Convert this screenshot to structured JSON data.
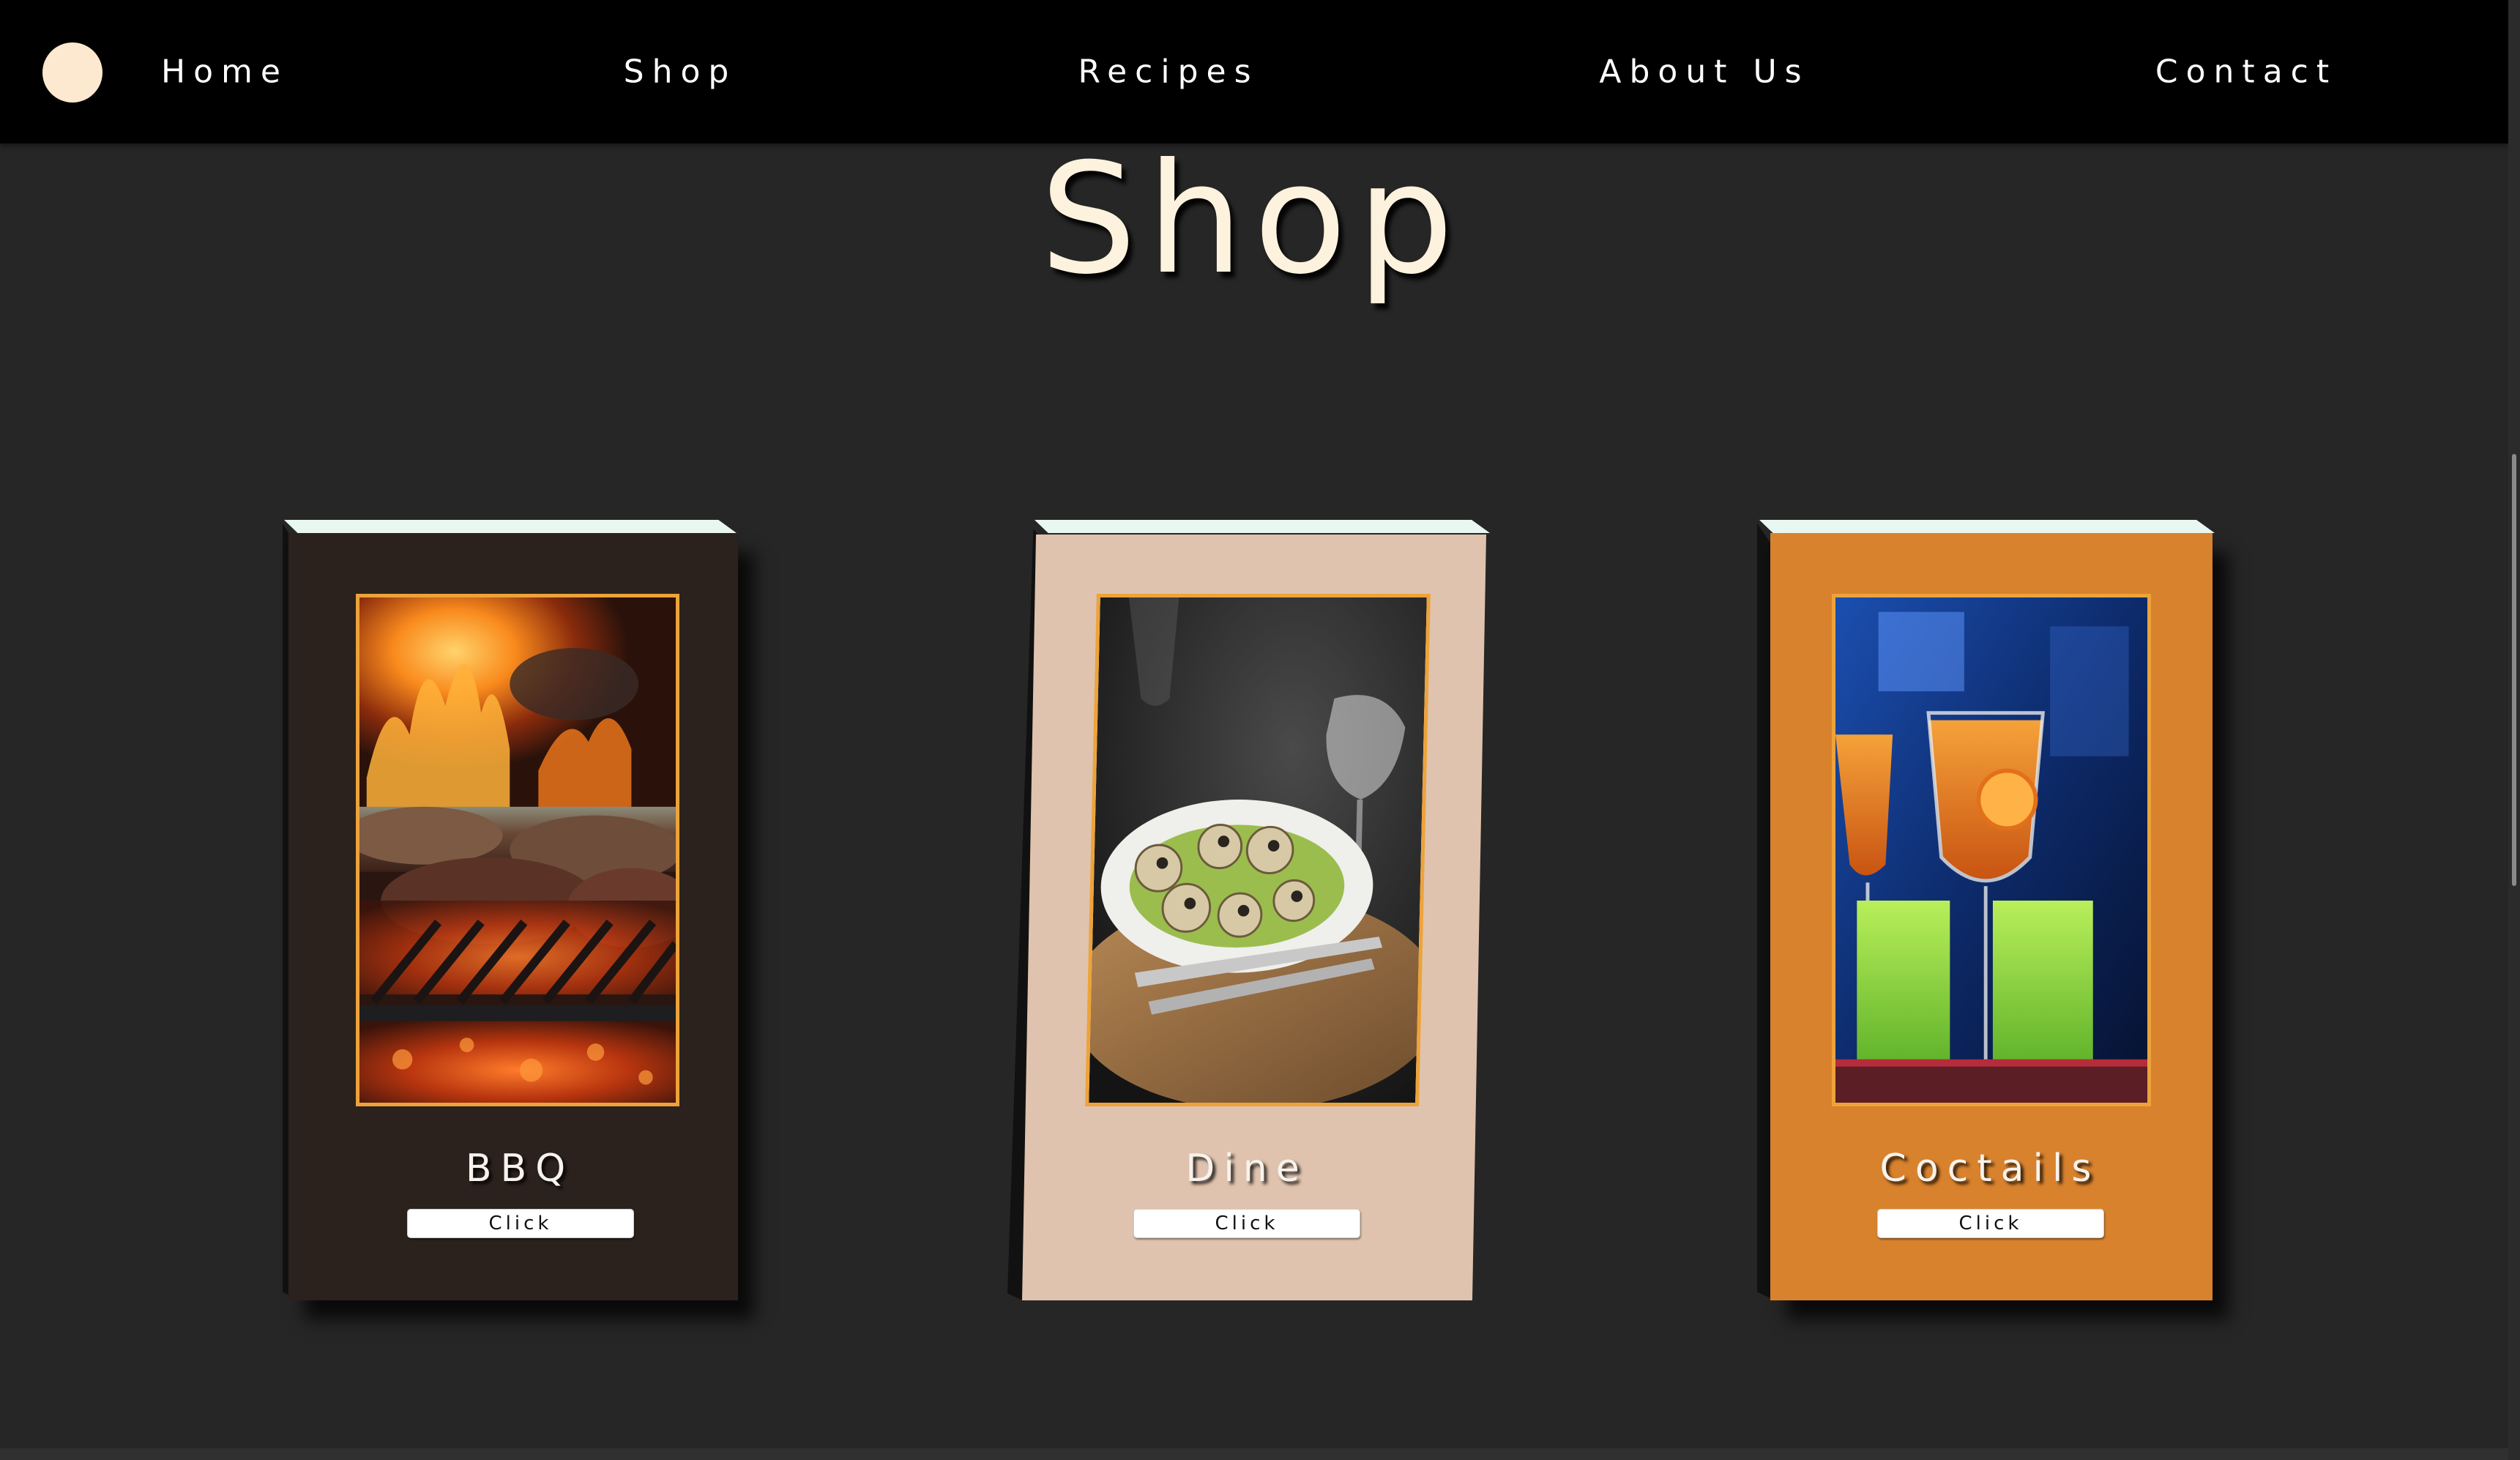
{
  "nav": {
    "logo": "circle-logo",
    "links": [
      "Home",
      "Shop",
      "Recipes",
      "About Us",
      "Contact"
    ]
  },
  "page": {
    "title": "Shop"
  },
  "cards": [
    {
      "label": "BBQ",
      "button": "Click",
      "background": "#2b221d",
      "image": "bbq-grill-steaks"
    },
    {
      "label": "Dine",
      "button": "Click",
      "background": "#dfc3ae",
      "image": "escargot-plate-with-wine-glass"
    },
    {
      "label": "Coctails",
      "button": "Click",
      "background": "#d9822d",
      "image": "cocktail-glasses-at-bar"
    }
  ],
  "colors": {
    "page_background": "#262626",
    "nav_background": "#000000",
    "logo": "#fde9cf",
    "title": "#fdf2de",
    "image_border": "#eda33a",
    "card_top_edge": "#e9f7f1"
  }
}
